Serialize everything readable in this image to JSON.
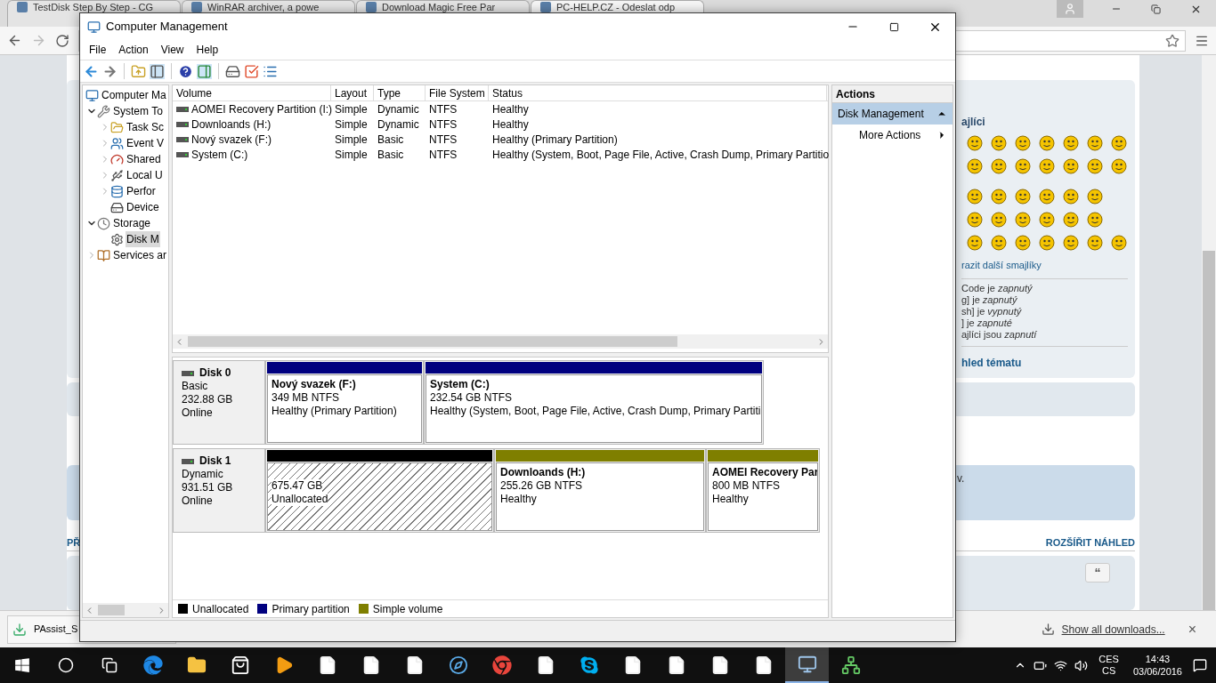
{
  "browser": {
    "tabs": [
      {
        "title": "TestDisk Step By Step - CG",
        "selected": false
      },
      {
        "title": "WinRAR archiver, a powe",
        "selected": false
      },
      {
        "title": "Download Magic Free Par",
        "selected": false
      },
      {
        "title": "PC-HELP.CZ - Odeslat odp",
        "selected": true
      }
    ],
    "page": {
      "smileys_heading": "ajlíci",
      "more_smileys": "razit další smajlíky",
      "settings": [
        "Code je *zapnutý*",
        "g] je *zapnutý*",
        "sh] je *vypnutý*",
        "] je *zapnuté*",
        "ajlíci jsou *zapnutí*"
      ],
      "topic_review": "hled tématu",
      "notice_fragment": "v.",
      "section_fragment": "PŘ",
      "expand_link": "ROZŠÍŘIT NÁHLED",
      "quote_button": "“"
    },
    "download_bar": {
      "item": "PAssist_S",
      "link": "Show all downloads...",
      "close": "×"
    }
  },
  "window": {
    "title": "Computer Management",
    "menu": [
      "File",
      "Action",
      "View",
      "Help"
    ],
    "tree": [
      {
        "label": "Computer Ma",
        "kind": "root",
        "selected": false,
        "children": [
          {
            "label": "System To",
            "kind": "branch",
            "expanded": true,
            "selected": false,
            "children": [
              {
                "label": "Task Sc",
                "kind": "branch",
                "expanded": false,
                "selected": false
              },
              {
                "label": "Event V",
                "kind": "branch",
                "expanded": false,
                "selected": false
              },
              {
                "label": "Shared",
                "kind": "branch",
                "expanded": false,
                "selected": false
              },
              {
                "label": "Local U",
                "kind": "branch",
                "expanded": false,
                "selected": false
              },
              {
                "label": "Perfor",
                "kind": "branch",
                "expanded": false,
                "selected": false
              },
              {
                "label": "Device",
                "kind": "leaf",
                "selected": false
              }
            ]
          },
          {
            "label": "Storage",
            "kind": "branch",
            "expanded": true,
            "selected": false,
            "children": [
              {
                "label": "Disk M",
                "kind": "leaf",
                "selected": true
              }
            ]
          },
          {
            "label": "Services ar",
            "kind": "branch",
            "expanded": false,
            "selected": false
          }
        ]
      }
    ],
    "volumes": {
      "columns": [
        "Volume",
        "Layout",
        "Type",
        "File System",
        "Status"
      ],
      "rows": [
        [
          "AOMEI Recovery Partition (I:)",
          "Simple",
          "Dynamic",
          "NTFS",
          "Healthy"
        ],
        [
          "Downloands (H:)",
          "Simple",
          "Dynamic",
          "NTFS",
          "Healthy"
        ],
        [
          "Nový svazek (F:)",
          "Simple",
          "Basic",
          "NTFS",
          "Healthy (Primary Partition)"
        ],
        [
          "System  (C:)",
          "Simple",
          "Basic",
          "NTFS",
          "Healthy (System, Boot, Page File, Active, Crash Dump, Primary Partitio"
        ]
      ]
    },
    "disks": [
      {
        "name": "Disk 0",
        "type": "Basic",
        "size": "232.88 GB",
        "state": "Online",
        "partitions": [
          {
            "kind": "volume",
            "color": "#00007f",
            "title": "Nový svazek  (F:)",
            "size": "349 MB NTFS",
            "status": "Healthy (Primary Partition)"
          },
          {
            "kind": "volume",
            "color": "#00007f",
            "title": "System  (C:)",
            "size": "232.54 GB NTFS",
            "status": "Healthy (System, Boot, Page File, Active, Crash Dump, Primary Partiti"
          }
        ]
      },
      {
        "name": "Disk 1",
        "type": "Dynamic",
        "size": "931.51 GB",
        "state": "Online",
        "partitions": [
          {
            "kind": "unallocated",
            "color": "#000000",
            "size": "675.47 GB",
            "status": "Unallocated"
          },
          {
            "kind": "volume",
            "color": "#7f7f00",
            "title": "Downloands  (H:)",
            "size": "255.26 GB NTFS",
            "status": "Healthy"
          },
          {
            "kind": "volume",
            "color": "#7f7f00",
            "title": "AOMEI Recovery Par",
            "size": "800 MB NTFS",
            "status": "Healthy"
          }
        ]
      }
    ],
    "legend": [
      {
        "label": "Unallocated",
        "color": "#000000"
      },
      {
        "label": "Primary partition",
        "color": "#00007f"
      },
      {
        "label": "Simple volume",
        "color": "#7f7f00"
      }
    ],
    "actions": {
      "header": "Actions",
      "items": [
        {
          "label": "Disk Management",
          "selected": true
        },
        {
          "label": "More Actions",
          "selected": false
        }
      ]
    }
  },
  "taskbar": {
    "apps": [
      {
        "kind": "start",
        "selected": false
      },
      {
        "kind": "search",
        "selected": false
      },
      {
        "kind": "task-view",
        "selected": false
      },
      {
        "kind": "edge",
        "selected": false
      },
      {
        "kind": "explorer",
        "selected": false
      },
      {
        "kind": "store",
        "selected": false
      },
      {
        "kind": "media",
        "selected": false
      },
      {
        "kind": "document",
        "selected": false
      },
      {
        "kind": "document",
        "selected": false
      },
      {
        "kind": "document",
        "selected": false
      },
      {
        "kind": "compass",
        "selected": false
      },
      {
        "kind": "chrome",
        "selected": false
      },
      {
        "kind": "document",
        "selected": false
      },
      {
        "kind": "skype",
        "selected": false
      },
      {
        "kind": "document",
        "selected": false
      },
      {
        "kind": "document",
        "selected": false
      },
      {
        "kind": "document",
        "selected": false
      },
      {
        "kind": "document",
        "selected": false
      },
      {
        "kind": "computer-management",
        "selected": true
      },
      {
        "kind": "network",
        "selected": false
      }
    ],
    "tray": {
      "language": "CES",
      "layout": "CS",
      "time": "14:43",
      "date": "03/06/2016"
    }
  }
}
